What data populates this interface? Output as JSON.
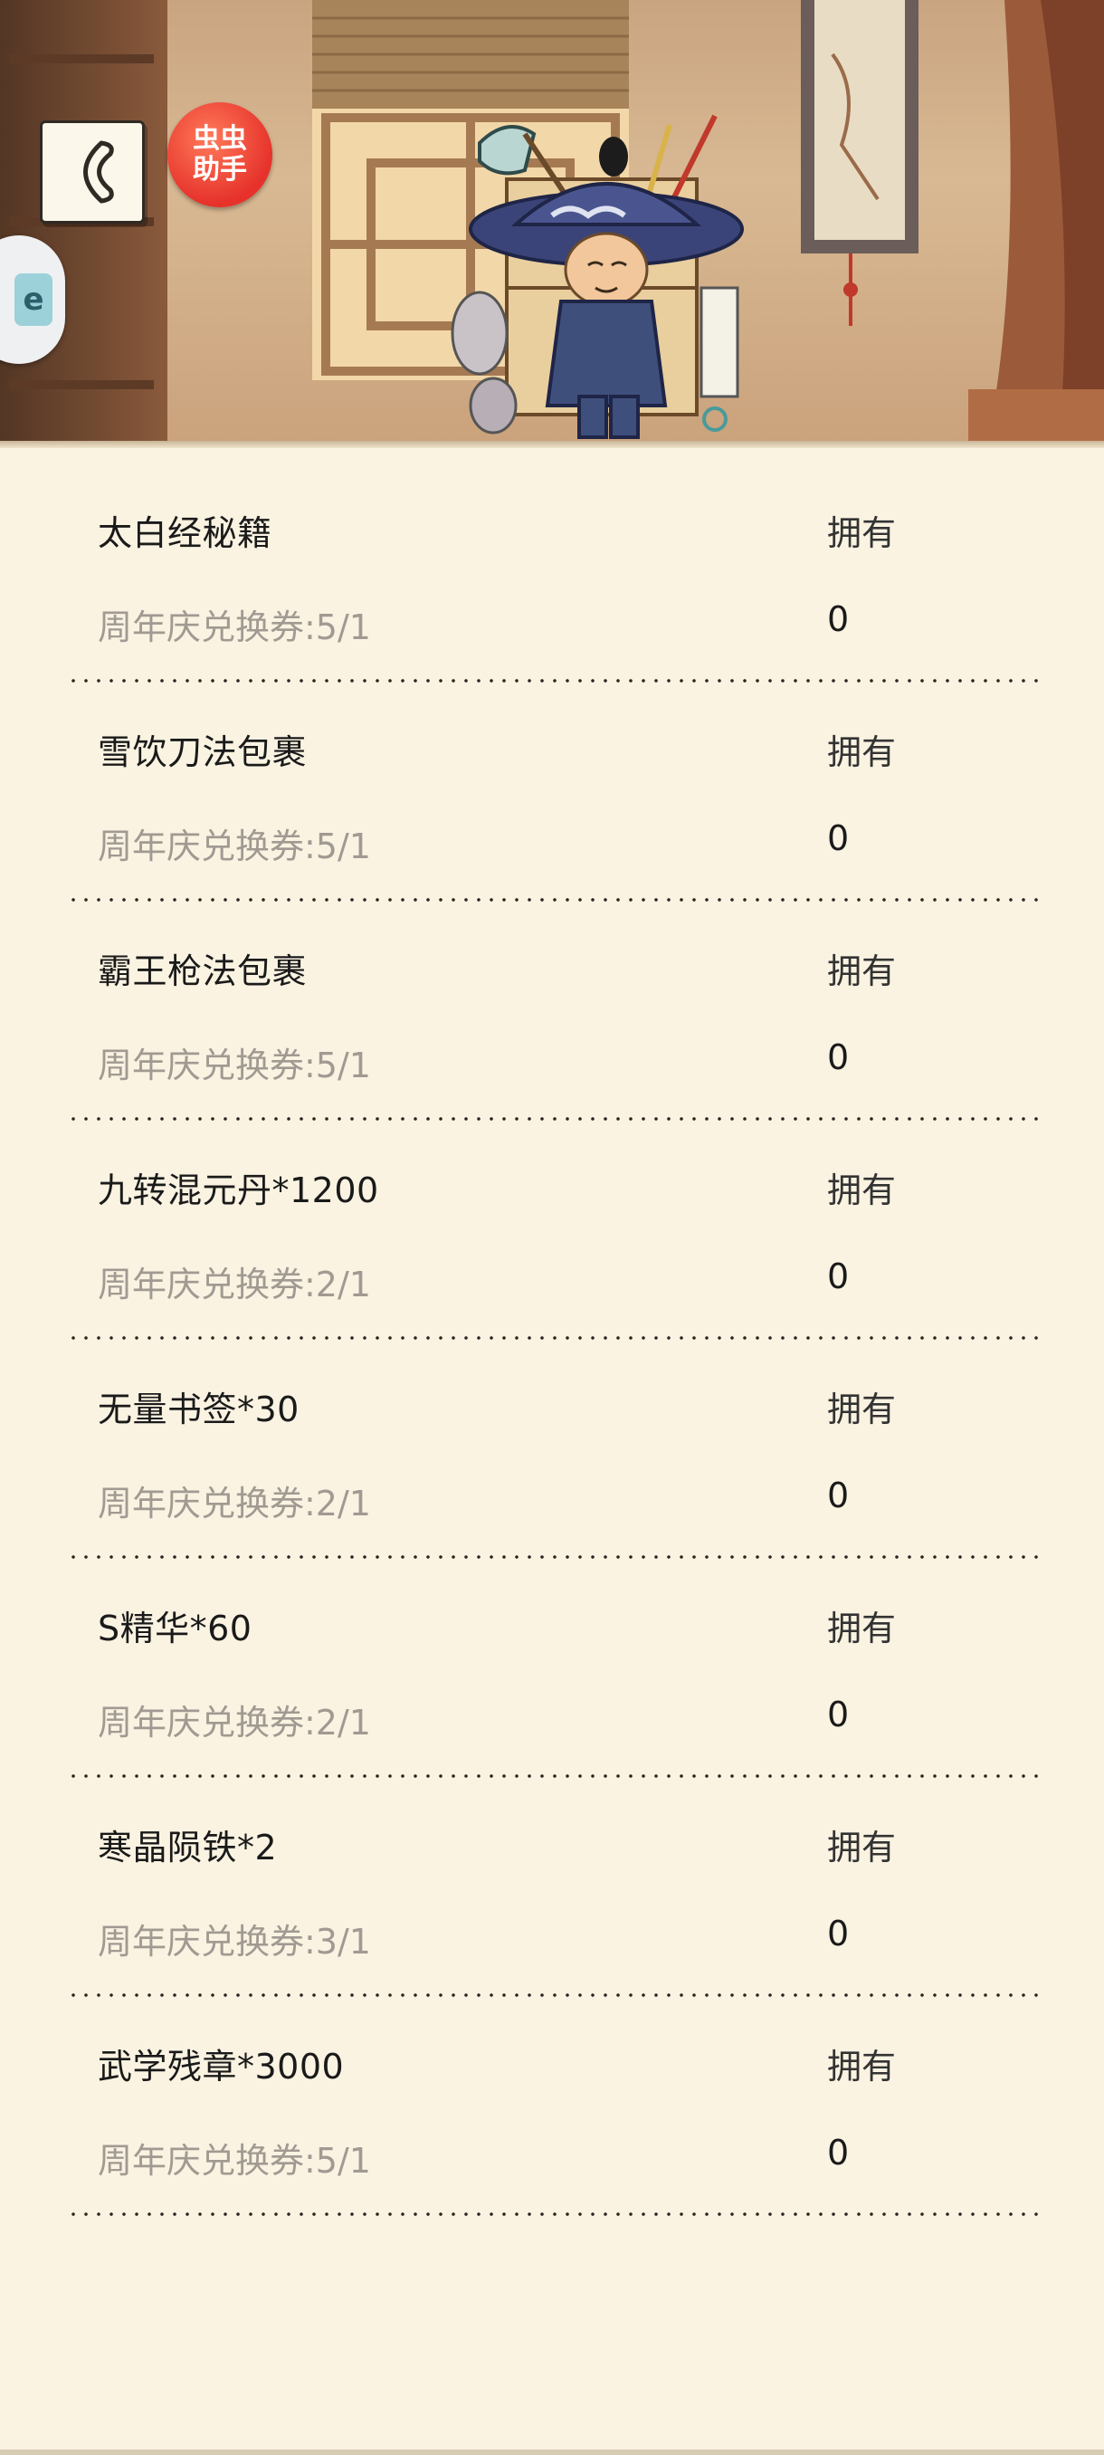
{
  "header": {
    "back_label": "",
    "helper_badge": [
      "虫虫",
      "助手"
    ],
    "side_tab_glyph": "e",
    "icons": [
      "back-arrow-icon",
      "helper-badge-icon",
      "side-tab-icon",
      "merchant-character-illustration"
    ]
  },
  "columns": {
    "owned_label": "拥有"
  },
  "items": [
    {
      "name": "太白经秘籍",
      "cost": "周年庆兑换券:5/1",
      "owned_label": "拥有",
      "owned": "0"
    },
    {
      "name": "雪饮刀法包裹",
      "cost": "周年庆兑换券:5/1",
      "owned_label": "拥有",
      "owned": "0"
    },
    {
      "name": "霸王枪法包裹",
      "cost": "周年庆兑换券:5/1",
      "owned_label": "拥有",
      "owned": "0"
    },
    {
      "name": "九转混元丹*1200",
      "cost": "周年庆兑换券:2/1",
      "owned_label": "拥有",
      "owned": "0"
    },
    {
      "name": "无量书签*30",
      "cost": "周年庆兑换券:2/1",
      "owned_label": "拥有",
      "owned": "0"
    },
    {
      "name": "S精华*60",
      "cost": "周年庆兑换券:2/1",
      "owned_label": "拥有",
      "owned": "0"
    },
    {
      "name": "寒晶陨铁*2",
      "cost": "周年庆兑换券:3/1",
      "owned_label": "拥有",
      "owned": "0"
    },
    {
      "name": "武学残章*3000",
      "cost": "周年庆兑换券:5/1",
      "owned_label": "拥有",
      "owned": "0"
    }
  ],
  "colors": {
    "background": "#faf3e2",
    "cost_text": "#a09a92",
    "badge": "#e6322b"
  }
}
